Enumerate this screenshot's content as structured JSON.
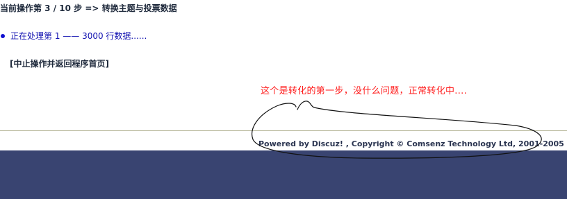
{
  "header": {
    "step_text": "当前操作第 3 / 10 步 => 转换主题与投票数据"
  },
  "progress": {
    "text": "正在处理第 1 —— 3000 行数据......"
  },
  "actions": {
    "abort_label": "[中止操作并返回程序首页]"
  },
  "annotation": {
    "text": "这个是转化的第一步，没什么问题，正常转化中....",
    "color": "#ff1a1a"
  },
  "footer": {
    "copyright": "Powered by Discuz! ,  Copyright © Comsenz Technology Ltd, 2001-2005",
    "band_color": "#394471"
  }
}
